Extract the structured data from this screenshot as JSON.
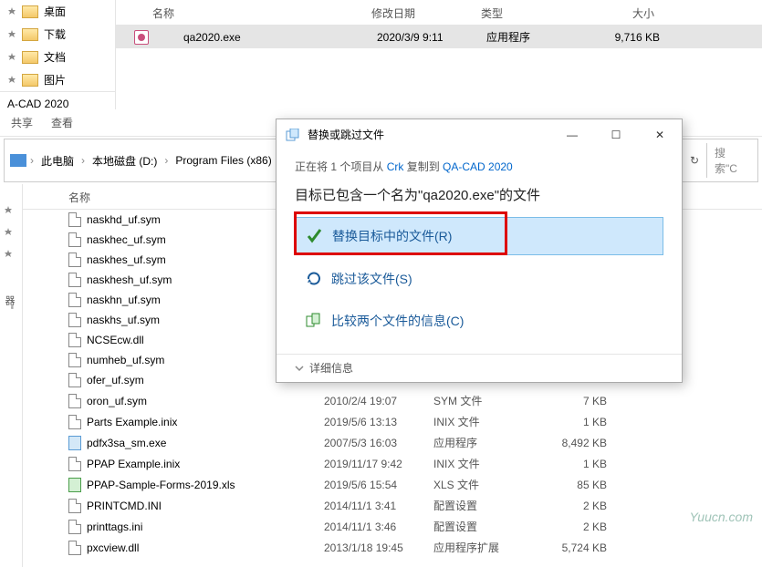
{
  "sidebar_top": {
    "items": [
      {
        "label": "桌面"
      },
      {
        "label": "下载"
      },
      {
        "label": "文档"
      },
      {
        "label": "图片"
      }
    ]
  },
  "app_title": "A-CAD 2020",
  "columns": {
    "name": "名称",
    "date": "修改日期",
    "type": "类型",
    "size": "大小"
  },
  "top_file": {
    "name": "qa2020.exe",
    "date": "2020/3/9 9:11",
    "type": "应用程序",
    "size": "9,716 KB"
  },
  "tabs": {
    "share": "共享",
    "view": "查看"
  },
  "breadcrumb": {
    "pc": "此电脑",
    "drive": "本地磁盘 (D:)",
    "folder1": "Program Files (x86)",
    "search_placeholder": "搜索\"C"
  },
  "list_panel": {
    "name_header": "名称",
    "side_label": "器\""
  },
  "files": [
    {
      "name": "naskhd_uf.sym",
      "date": "",
      "type": "",
      "size": "",
      "icon": "file"
    },
    {
      "name": "naskhec_uf.sym",
      "date": "",
      "type": "",
      "size": "",
      "icon": "file"
    },
    {
      "name": "naskhes_uf.sym",
      "date": "",
      "type": "",
      "size": "",
      "icon": "file"
    },
    {
      "name": "naskhesh_uf.sym",
      "date": "",
      "type": "",
      "size": "",
      "icon": "file"
    },
    {
      "name": "naskhn_uf.sym",
      "date": "",
      "type": "",
      "size": "",
      "icon": "file"
    },
    {
      "name": "naskhs_uf.sym",
      "date": "",
      "type": "",
      "size": "",
      "icon": "file"
    },
    {
      "name": "NCSEcw.dll",
      "date": "",
      "type": "",
      "size": "",
      "icon": "file"
    },
    {
      "name": "numheb_uf.sym",
      "date": "",
      "type": "",
      "size": "",
      "icon": "file"
    },
    {
      "name": "ofer_uf.sym",
      "date": "",
      "type": "",
      "size": "",
      "icon": "file"
    },
    {
      "name": "oron_uf.sym",
      "date": "2010/2/4 19:07",
      "type": "SYM 文件",
      "size": "7 KB",
      "icon": "file"
    },
    {
      "name": "Parts Example.inix",
      "date": "2019/5/6 13:13",
      "type": "INIX 文件",
      "size": "1 KB",
      "icon": "file"
    },
    {
      "name": "pdfx3sa_sm.exe",
      "date": "2007/5/3 16:03",
      "type": "应用程序",
      "size": "8,492 KB",
      "icon": "exe"
    },
    {
      "name": "PPAP Example.inix",
      "date": "2019/11/17 9:42",
      "type": "INIX 文件",
      "size": "1 KB",
      "icon": "file"
    },
    {
      "name": "PPAP-Sample-Forms-2019.xls",
      "date": "2019/5/6 15:54",
      "type": "XLS 文件",
      "size": "85 KB",
      "icon": "xls"
    },
    {
      "name": "PRINTCMD.INI",
      "date": "2014/11/1 3:41",
      "type": "配置设置",
      "size": "2 KB",
      "icon": "file"
    },
    {
      "name": "printtags.ini",
      "date": "2014/11/1 3:46",
      "type": "配置设置",
      "size": "2 KB",
      "icon": "file"
    },
    {
      "name": "pxcview.dll",
      "date": "2013/1/18 19:45",
      "type": "应用程序扩展",
      "size": "5,724 KB",
      "icon": "file"
    }
  ],
  "dialog": {
    "title": "替换或跳过文件",
    "copying_prefix": "正在将 1 个项目从 ",
    "src": "Crk",
    "copying_mid": " 复制到 ",
    "dst": "QA-CAD 2020",
    "heading": "目标已包含一个名为\"qa2020.exe\"的文件",
    "options": {
      "replace": "替换目标中的文件(R)",
      "skip": "跳过该文件(S)",
      "compare": "比较两个文件的信息(C)"
    },
    "details": "详细信息",
    "minimize": "—",
    "maximize": "☐",
    "close": "✕"
  },
  "watermark": "Yuucn.com"
}
